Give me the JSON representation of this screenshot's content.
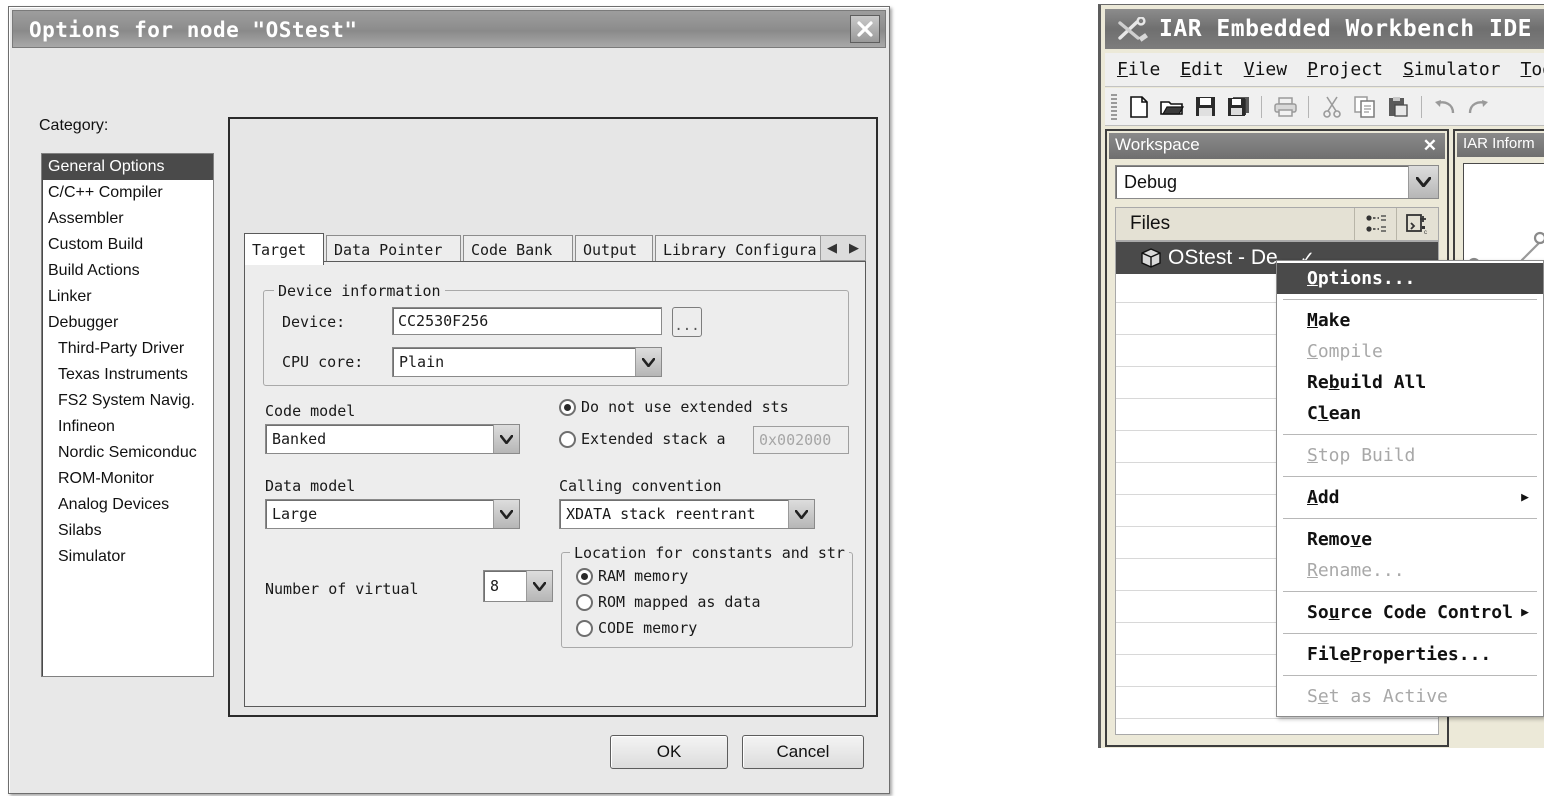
{
  "dialog": {
    "title": "Options for node \"OStest\"",
    "close_icon": "close-icon",
    "category_label": "Category:",
    "categories": [
      {
        "label": "General Options",
        "selected": true,
        "indent": false
      },
      {
        "label": "C/C++ Compiler",
        "selected": false,
        "indent": false
      },
      {
        "label": "Assembler",
        "selected": false,
        "indent": false
      },
      {
        "label": "Custom Build",
        "selected": false,
        "indent": false
      },
      {
        "label": "Build Actions",
        "selected": false,
        "indent": false
      },
      {
        "label": "Linker",
        "selected": false,
        "indent": false
      },
      {
        "label": "Debugger",
        "selected": false,
        "indent": false
      },
      {
        "label": "Third-Party Driver",
        "selected": false,
        "indent": true
      },
      {
        "label": "Texas Instruments",
        "selected": false,
        "indent": true
      },
      {
        "label": "FS2 System Navig.",
        "selected": false,
        "indent": true
      },
      {
        "label": "Infineon",
        "selected": false,
        "indent": true
      },
      {
        "label": "Nordic Semiconduc",
        "selected": false,
        "indent": true
      },
      {
        "label": "ROM-Monitor",
        "selected": false,
        "indent": true
      },
      {
        "label": "Analog Devices",
        "selected": false,
        "indent": true
      },
      {
        "label": "Silabs",
        "selected": false,
        "indent": true
      },
      {
        "label": "Simulator",
        "selected": false,
        "indent": true
      }
    ],
    "tabs": [
      {
        "label": "Target",
        "active": true
      },
      {
        "label": "Data Pointer",
        "active": false
      },
      {
        "label": "Code Bank",
        "active": false
      },
      {
        "label": "Output",
        "active": false
      },
      {
        "label": "Library Configura",
        "active": false
      }
    ],
    "tab_scroll_left": "◀",
    "tab_scroll_right": "▶",
    "device_group": {
      "title": "Device information",
      "device_label": "Device:",
      "device_value": "CC2530F256",
      "browse_label": "...",
      "cpu_label": "CPU core:",
      "cpu_value": "Plain"
    },
    "code_model": {
      "label": "Code model",
      "value": "Banked"
    },
    "data_model": {
      "label": "Data model",
      "value": "Large"
    },
    "stack": {
      "option_no_ext": "Do not use extended sts",
      "option_ext": "Extended stack a",
      "ext_address": "0x002000",
      "selected": "no_ext"
    },
    "calling_convention": {
      "label": "Calling convention",
      "value": "XDATA stack reentrant"
    },
    "virtual_registers": {
      "label": "Number of virtual",
      "value": "8"
    },
    "location_group": {
      "title": "Location for constants and str",
      "options": [
        {
          "label": "RAM memory",
          "selected": true
        },
        {
          "label": "ROM mapped as data",
          "selected": false
        },
        {
          "label": "CODE memory",
          "selected": false
        }
      ]
    },
    "ok_label": "OK",
    "cancel_label": "Cancel"
  },
  "ide": {
    "title": "IAR Embedded Workbench IDE",
    "app_icon": "wrench-screwdriver-icon",
    "menus": [
      {
        "label": "File",
        "accel": "F"
      },
      {
        "label": "Edit",
        "accel": "E"
      },
      {
        "label": "View",
        "accel": "V"
      },
      {
        "label": "Project",
        "accel": "P"
      },
      {
        "label": "Simulator",
        "accel": "S"
      },
      {
        "label": "Tool",
        "accel": "T"
      }
    ],
    "toolbar": [
      {
        "name": "new-file-icon",
        "enabled": true
      },
      {
        "name": "open-folder-icon",
        "enabled": true
      },
      {
        "name": "save-icon",
        "enabled": true
      },
      {
        "name": "save-all-icon",
        "enabled": true
      },
      {
        "name": "print-icon",
        "enabled": false
      },
      {
        "name": "cut-icon",
        "enabled": false
      },
      {
        "name": "copy-icon",
        "enabled": false
      },
      {
        "name": "paste-icon",
        "enabled": false
      },
      {
        "name": "undo-icon",
        "enabled": false
      },
      {
        "name": "redo-icon",
        "enabled": false
      }
    ],
    "workspace": {
      "title": "Workspace",
      "close_label": "✕",
      "config_value": "Debug",
      "files_header": "Files",
      "header_buttons": [
        "dependency-tree-icon",
        "build-status-icon"
      ],
      "root_node": "OStest - De",
      "root_icon": "project-cube-icon",
      "root_check": "✓"
    },
    "info_panel": {
      "title": "IAR Inform"
    }
  },
  "context_menu": {
    "items": [
      {
        "label": "Options...",
        "accel": "O",
        "state": "highlight",
        "submenu": false,
        "sep_after": true
      },
      {
        "label": "Make",
        "accel": "M",
        "state": "normal",
        "submenu": false,
        "sep_after": false
      },
      {
        "label": "Compile",
        "accel": "C",
        "state": "disabled",
        "submenu": false,
        "sep_after": false
      },
      {
        "label": "Rebuild All",
        "accel": "b",
        "state": "normal",
        "submenu": false,
        "sep_after": false
      },
      {
        "label": "Clean",
        "accel": "l",
        "state": "normal",
        "submenu": false,
        "sep_after": true
      },
      {
        "label": "Stop Build",
        "accel": "S",
        "state": "disabled",
        "submenu": false,
        "sep_after": true
      },
      {
        "label": "Add",
        "accel": "A",
        "state": "normal",
        "submenu": true,
        "sep_after": true
      },
      {
        "label": "Remove",
        "accel": "v",
        "state": "normal",
        "submenu": false,
        "sep_after": false
      },
      {
        "label": "Rename...",
        "accel": "R",
        "state": "disabled",
        "submenu": false,
        "sep_after": true
      },
      {
        "label": "Source Code Control",
        "accel": "u",
        "state": "normal",
        "submenu": true,
        "sep_after": true
      },
      {
        "label": "File Properties...",
        "accel": "P",
        "state": "normal",
        "submenu": false,
        "sep_after": true
      },
      {
        "label": "Set as Active",
        "accel": "e",
        "state": "disabled",
        "submenu": false,
        "sep_after": false
      }
    ],
    "submenu_arrow": "▶"
  },
  "colors": {
    "dialog_face": "#e8e8e8",
    "selection": "#4a4a4a",
    "titlebar": "#8f8f8f",
    "panel_face": "#ece9d8",
    "disabled_text": "#a8a8a8"
  }
}
